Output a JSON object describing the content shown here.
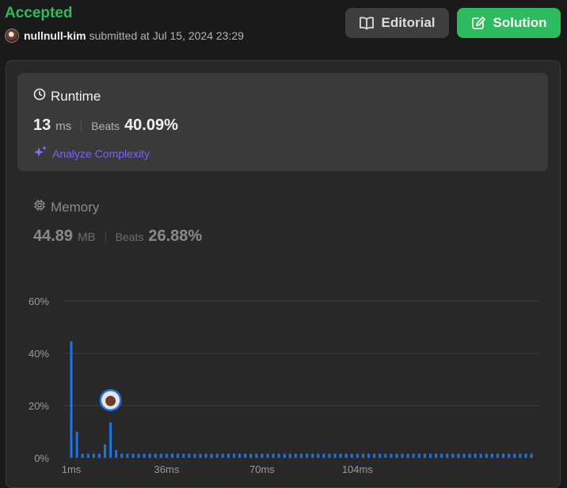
{
  "header": {
    "status": "Accepted",
    "username": "nullnull-kim",
    "submitted_text": "submitted at Jul 15, 2024 23:29"
  },
  "buttons": {
    "editorial": "Editorial",
    "solution": "Solution"
  },
  "runtime": {
    "title": "Runtime",
    "value": "13",
    "unit": "ms",
    "beats_label": "Beats",
    "beats_value": "40.09%",
    "analyze_label": "Analyze Complexity"
  },
  "memory": {
    "title": "Memory",
    "value": "44.89",
    "unit": "MB",
    "beats_label": "Beats",
    "beats_value": "26.88%"
  },
  "colors": {
    "accent_green": "#2cbb5d",
    "bar_blue": "#1a73e8",
    "analyze_purple": "#7b61ff"
  },
  "chart_data": {
    "type": "bar",
    "ylim": [
      0,
      60
    ],
    "y_ticks": [
      "0%",
      "20%",
      "40%",
      "60%"
    ],
    "x_tick_labels": [
      "1ms",
      "36ms",
      "70ms",
      "104ms"
    ],
    "grid": true,
    "current_marker_index": 7,
    "values": [
      44.6,
      10.0,
      1.6,
      1.6,
      1.6,
      1.6,
      5.2,
      13.6,
      3.0,
      1.6,
      1.6,
      1.6,
      1.6,
      1.6,
      1.6,
      1.6,
      1.6,
      1.6,
      1.6,
      1.6,
      1.6,
      1.6,
      1.6,
      1.6,
      1.6,
      1.6,
      1.6,
      1.6,
      1.6,
      1.6,
      1.6,
      1.6,
      1.6,
      1.6,
      1.6,
      1.6,
      1.6,
      1.6,
      1.6,
      1.6,
      1.6,
      1.6,
      1.6,
      1.6,
      1.6,
      1.6,
      1.6,
      1.6,
      1.6,
      1.6,
      1.6,
      1.6,
      1.6,
      1.6,
      1.6,
      1.6,
      1.6,
      1.6,
      1.6,
      1.6,
      1.6,
      1.6,
      1.6,
      1.6,
      1.6,
      1.6,
      1.6,
      1.6,
      1.6,
      1.6,
      1.6,
      1.6,
      1.6,
      1.6,
      1.6,
      1.6,
      1.6,
      1.6,
      1.6,
      1.6,
      1.6,
      1.6,
      1.6
    ]
  }
}
